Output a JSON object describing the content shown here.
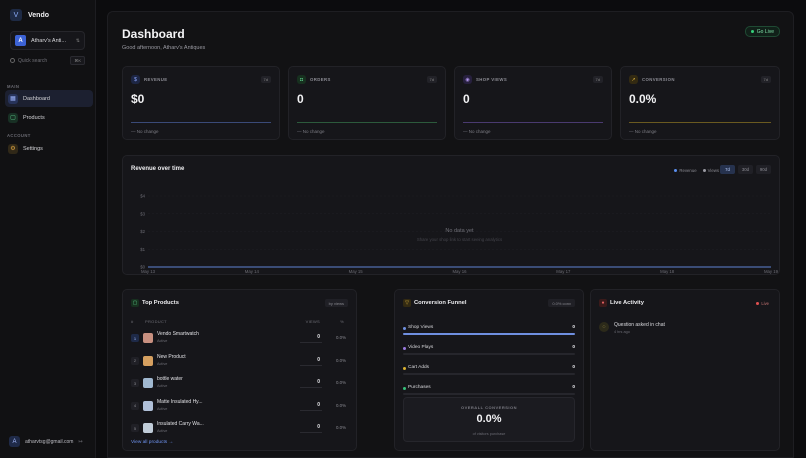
{
  "brand": {
    "name": "Vendo",
    "logo": "V"
  },
  "store": {
    "avatar": "A",
    "name": "Atharv's Anti..."
  },
  "search": {
    "placeholder": "Quick search",
    "shortcut": "⌘K"
  },
  "nav": {
    "main_label": "MAIN",
    "account_label": "ACCOUNT",
    "items": [
      {
        "label": "Dashboard",
        "icon": "grid-icon",
        "active": true
      },
      {
        "label": "Products",
        "icon": "box-icon",
        "active": false
      },
      {
        "label": "Settings",
        "icon": "gear-icon",
        "active": false
      }
    ]
  },
  "user": {
    "avatar": "A",
    "email": "atharvtsg@gmail.com"
  },
  "header": {
    "title": "Dashboard",
    "subtitle": "Good afternoon, Atharv's Antiques",
    "go_live": "Go Live"
  },
  "stats": [
    {
      "label": "REVENUE",
      "badge": "7d",
      "value": "$0",
      "change": "— No change",
      "icon": "dollar-icon",
      "accent": "#5b7fe0"
    },
    {
      "label": "ORDERS",
      "badge": "7d",
      "value": "0",
      "change": "— No change",
      "icon": "bag-icon",
      "accent": "#36c07a"
    },
    {
      "label": "SHOP VIEWS",
      "badge": "7d",
      "value": "0",
      "change": "— No change",
      "icon": "eye-icon",
      "accent": "#9a7ae0"
    },
    {
      "label": "CONVERSION",
      "badge": "7d",
      "value": "0.0%",
      "change": "— No change",
      "icon": "trend-icon",
      "accent": "#d8b030"
    }
  ],
  "revenue_chart": {
    "title": "Revenue over time",
    "legend": [
      "Revenue",
      "Views"
    ],
    "ranges": [
      "7d",
      "30d",
      "90d"
    ],
    "active_range": "7d",
    "empty_title": "No data yet",
    "empty_sub": "Share your shop link to start seeing analytics"
  },
  "chart_data": {
    "type": "line",
    "title": "Revenue over time",
    "x": [
      "May 13",
      "May 14",
      "May 15",
      "May 16",
      "May 17",
      "May 18",
      "May 19"
    ],
    "y_ticks": [
      "$4",
      "$3",
      "$2",
      "$1",
      "$0"
    ],
    "series": [
      {
        "name": "Revenue",
        "values": [
          0,
          0,
          0,
          0,
          0,
          0,
          0
        ]
      },
      {
        "name": "Views",
        "values": [
          0,
          0,
          0,
          0,
          0,
          0,
          0
        ]
      }
    ],
    "ylim": [
      0,
      4
    ],
    "grid": true,
    "legend_position": "top-right"
  },
  "top_products": {
    "title": "Top Products",
    "badge": "by views",
    "headers": {
      "rank": "#",
      "product": "PRODUCT",
      "views": "VIEWS",
      "pct": "%"
    },
    "rows": [
      {
        "rank": "1",
        "name": "Vendo Smartwatch",
        "status": "Active",
        "views": "0",
        "pct": "0.0%",
        "thumb": "#c89080"
      },
      {
        "rank": "2",
        "name": "New Product",
        "status": "Active",
        "views": "0",
        "pct": "0.0%",
        "thumb": "#d6a060"
      },
      {
        "rank": "3",
        "name": "bottle water",
        "status": "Active",
        "views": "0",
        "pct": "0.0%",
        "thumb": "#a0b8d0"
      },
      {
        "rank": "4",
        "name": "Matte Insulated Hy...",
        "status": "Active",
        "views": "0",
        "pct": "0.0%",
        "thumb": "#b0c0d8"
      },
      {
        "rank": "5",
        "name": "Insulated Carry Wa...",
        "status": "Active",
        "views": "0",
        "pct": "0.0%",
        "thumb": "#c0ccd8"
      }
    ],
    "view_all": "View all products →"
  },
  "funnel": {
    "title": "Conversion Funnel",
    "badge": "0.0% conv",
    "steps": [
      {
        "label": "Shop Views",
        "value": "0",
        "fill": 1.0,
        "color": "#6f8fe0"
      },
      {
        "label": "Video Plays",
        "value": "0",
        "fill": 0,
        "color": "#9a7ae0"
      },
      {
        "label": "Cart Adds",
        "value": "0",
        "fill": 0,
        "color": "#d8b030"
      },
      {
        "label": "Purchases",
        "value": "0",
        "fill": 0,
        "color": "#36c07a"
      }
    ],
    "overall_label": "OVERALL CONVERSION",
    "overall_value": "0.0%",
    "overall_sub": "of visitors purchase"
  },
  "live": {
    "title": "Live Activity",
    "badge": "Live",
    "items": [
      {
        "title": "Question asked in chat",
        "time": "4 hrs ago",
        "icon": "chat-icon"
      }
    ]
  }
}
